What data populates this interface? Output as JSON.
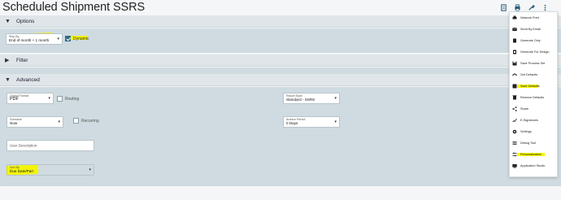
{
  "title": "Scheduled Shipment SSRS",
  "toolbar": {
    "icons": [
      "document-icon",
      "print-icon",
      "tools-icon",
      "more-icon"
    ]
  },
  "sections": {
    "options": {
      "label": "Options",
      "chevron": "▼"
    },
    "filter": {
      "label": "Filter",
      "chevron": "▶"
    },
    "advanced": {
      "label": "Advanced",
      "chevron": "▼"
    }
  },
  "options": {
    "ship_by": {
      "label": "Ship By",
      "value": "End of month + 1 month"
    },
    "dynamic": {
      "label": "Dynamic",
      "checked": true
    }
  },
  "advanced": {
    "output_format": {
      "label": "Output Format",
      "value": "PDF"
    },
    "routing": {
      "label": "Routing",
      "checked": false
    },
    "report_style": {
      "label": "Report Style",
      "value": "Standard - SSRS"
    },
    "schedule": {
      "label": "Schedule",
      "value": "Now"
    },
    "recurring": {
      "label": "Recurring",
      "checked": false
    },
    "archive_period": {
      "label": "Archive Period",
      "value": "0 Days"
    },
    "user_description": {
      "placeholder": "User Description"
    },
    "sort_by": {
      "label": "Sort By",
      "value": "Due Date/Part"
    }
  },
  "menu": {
    "items": [
      {
        "label": "Network Print",
        "icon": "network-print-icon",
        "highlight": false
      },
      {
        "label": "Send By Email",
        "icon": "email-icon",
        "highlight": false
      },
      {
        "label": "Generate Only",
        "icon": "generate-icon",
        "highlight": false
      },
      {
        "label": "Generate For Design",
        "icon": "design-icon",
        "highlight": false
      },
      {
        "label": "Save Process Set",
        "icon": "save-icon",
        "highlight": false
      },
      {
        "label": "Get Defaults",
        "icon": "get-defaults-icon",
        "highlight": false
      },
      {
        "label": "Save Defaults",
        "icon": "save-defaults-icon",
        "highlight": true
      },
      {
        "label": "Remove Defaults",
        "icon": "remove-icon",
        "highlight": false
      },
      {
        "label": "Share",
        "icon": "share-icon",
        "highlight": false
      },
      {
        "label": "E-Signatures",
        "icon": "signature-icon",
        "highlight": false
      },
      {
        "label": "Settings",
        "icon": "settings-icon",
        "highlight": false
      },
      {
        "label": "Debug Tool",
        "icon": "debug-icon",
        "highlight": false
      },
      {
        "label": "Personalization",
        "icon": "personalization-icon",
        "highlight": true
      },
      {
        "label": "Application Studio",
        "icon": "studio-icon",
        "highlight": false
      }
    ]
  },
  "colors": {
    "highlight": "#f4f500",
    "accent": "#2f6f88",
    "panel": "#cfdbe0",
    "header": "#dfe5e9"
  }
}
